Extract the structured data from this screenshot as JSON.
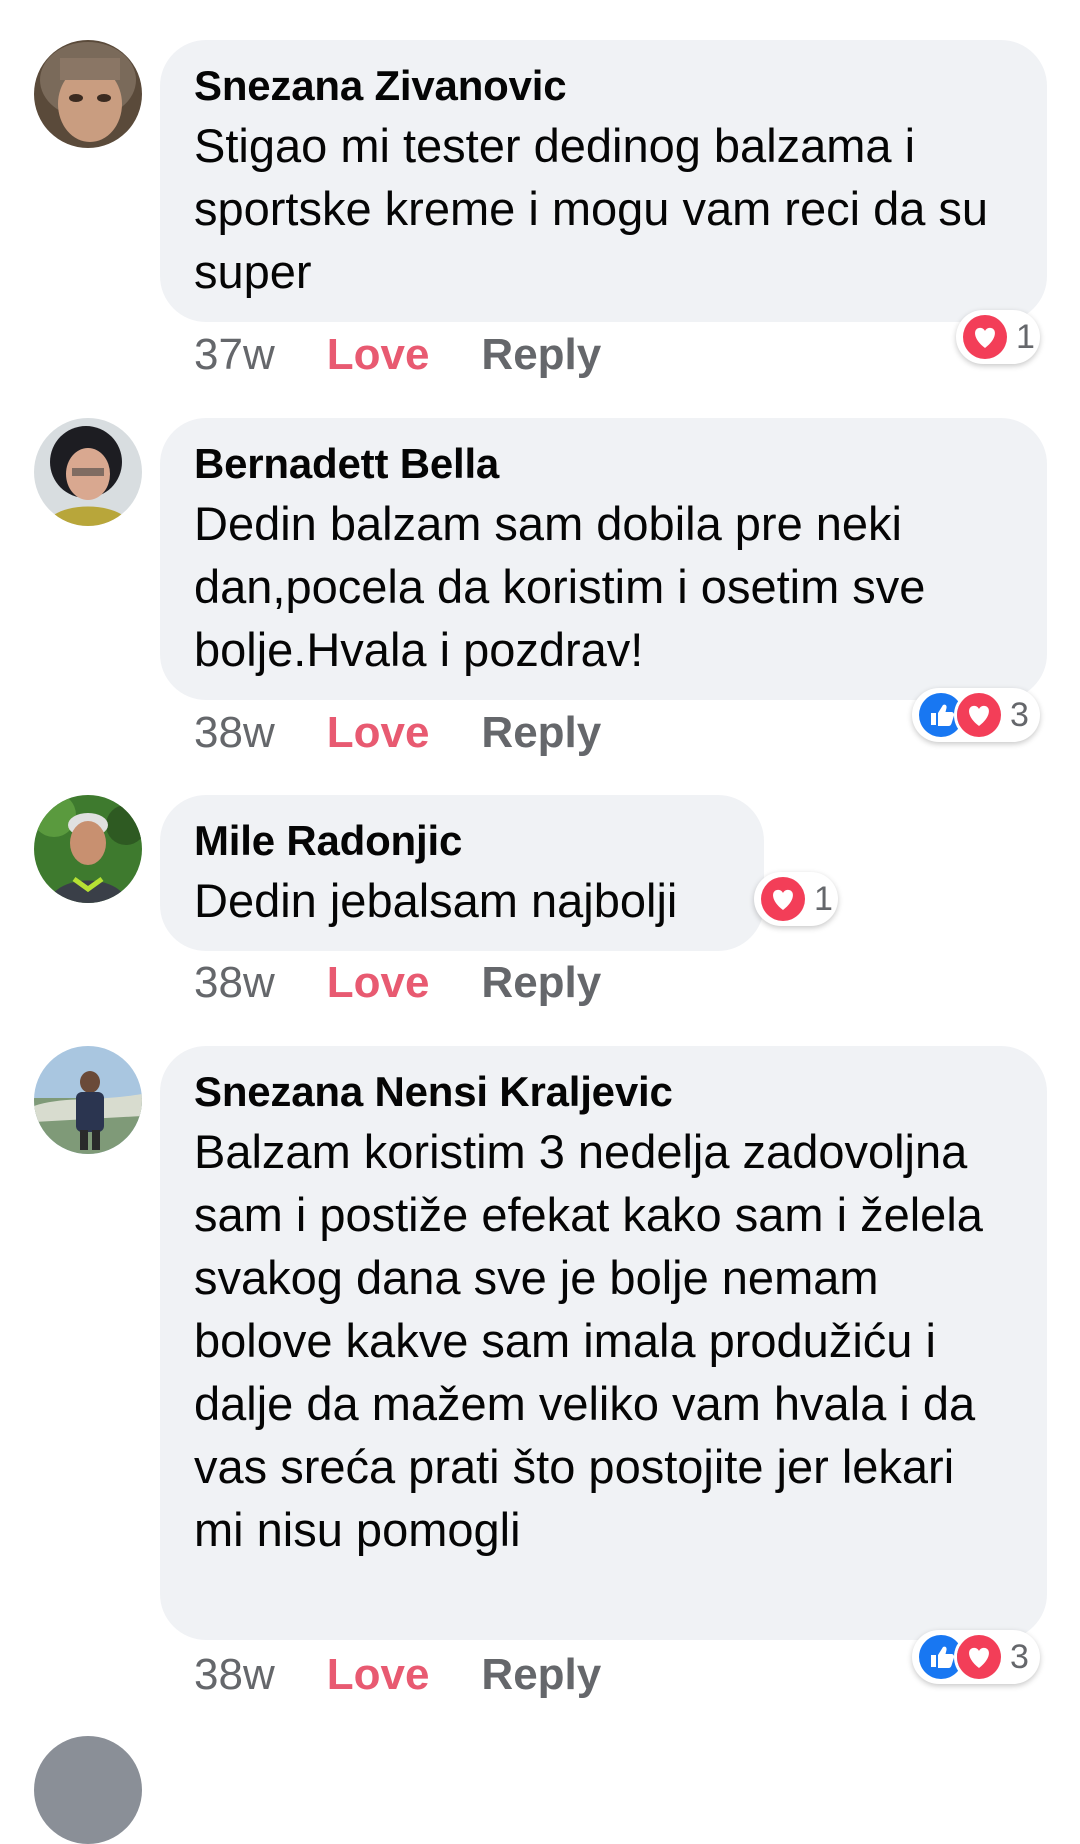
{
  "comments": [
    {
      "author": "Snezana Zivanovic",
      "text": "Stigao mi tester dedinog balzama i sportske kreme i mogu vam reci da su super",
      "time": "37w",
      "love_label": "Love",
      "reply_label": "Reply",
      "reaction_count": "1",
      "reactions": [
        "love"
      ]
    },
    {
      "author": "Bernadett Bella",
      "text": "Dedin balzam sam dobila pre neki dan,pocela da koristim i osetim sve bolje.Hvala i pozdrav!",
      "time": "38w",
      "love_label": "Love",
      "reply_label": "Reply",
      "reaction_count": "3",
      "reactions": [
        "like",
        "love"
      ]
    },
    {
      "author": "Mile Radonjic",
      "text": "Dedin jebalsam najbolji",
      "time": "38w",
      "love_label": "Love",
      "reply_label": "Reply",
      "reaction_count": "1",
      "reactions": [
        "love"
      ]
    },
    {
      "author": "Snezana Nensi Kraljevic",
      "text": "Balzam koristim 3 nedelja zadovoljna sam i postiže efekat kako sam i želela svakog dana sve je bolje nemam bolove kakve sam imala produžiću i dalje da mažem veliko vam hvala i da vas sreća prati što postojite jer lekari mi nisu pomogli",
      "time": "38w",
      "love_label": "Love",
      "reply_label": "Reply",
      "reaction_count": "3",
      "reactions": [
        "like",
        "love"
      ]
    }
  ],
  "icons": {
    "like": "like-icon",
    "love": "love-icon"
  },
  "colors": {
    "bubble": "#f0f2f5",
    "love_accent": "#e85a71",
    "like_blue": "#1877f2",
    "love_red": "#f33e58",
    "meta_gray": "#65676b"
  }
}
